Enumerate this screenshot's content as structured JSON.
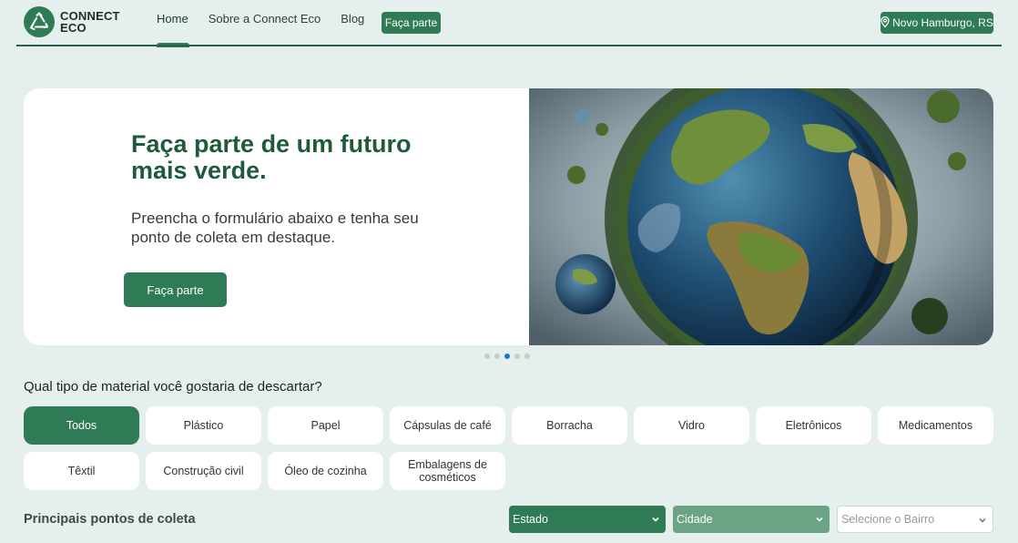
{
  "brand": {
    "line1": "CONNECT",
    "line2": "ECO"
  },
  "nav": {
    "home": "Home",
    "sobre": "Sobre a Connect Eco",
    "blog": "Blog",
    "faca_parte": "Faça parte"
  },
  "location": {
    "label": "Novo Hamburgo, RS",
    "icon": "map-pin-icon"
  },
  "hero": {
    "title": "Faça parte de um futuro mais verde.",
    "subtitle": "Preencha o formulário abaixo e tenha seu ponto de coleta em destaque.",
    "button": "Faça parte",
    "image": "earth-globe-image"
  },
  "carousel": {
    "count": 5,
    "active_index": 2
  },
  "materials": {
    "question": "Qual tipo de material você gostaria de descartar?",
    "options": [
      {
        "label": "Todos",
        "active": true
      },
      {
        "label": "Plástico",
        "active": false
      },
      {
        "label": "Papel",
        "active": false
      },
      {
        "label": "Cápsulas de café",
        "active": false
      },
      {
        "label": "Borracha",
        "active": false
      },
      {
        "label": "Vidro",
        "active": false
      },
      {
        "label": "Eletrônicos",
        "active": false
      },
      {
        "label": "Medicamentos",
        "active": false
      },
      {
        "label": "Têxtil",
        "active": false
      },
      {
        "label": "Construção civil",
        "active": false
      },
      {
        "label": "Óleo de cozinha",
        "active": false
      },
      {
        "label": "Embalagens de cosméticos",
        "active": false
      }
    ]
  },
  "points": {
    "title": "Principais pontos de coleta",
    "estado": "Estado",
    "cidade": "Cidade",
    "bairro_placeholder": "Selecione o Bairro"
  },
  "colors": {
    "primary": "#2f7b56",
    "background": "#e5efee",
    "title_green": "#1f5b3b",
    "active_dot": "#1b79c4"
  }
}
